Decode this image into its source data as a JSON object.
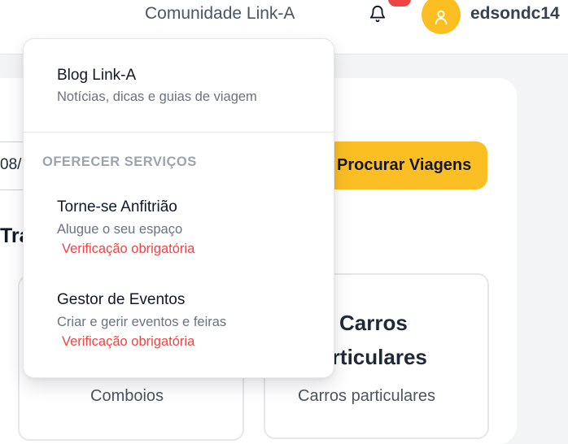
{
  "header": {
    "community_label": "Comunidade Link-A",
    "username": "edsondc14"
  },
  "icons": {
    "notifications": "bell-icon",
    "user": "user-icon"
  },
  "colors": {
    "accent": "#fbbf24",
    "badge": "#ef4444",
    "warning_text": "#ef4444"
  },
  "search": {
    "date_value": "08/",
    "button_label": "Procurar Viagens"
  },
  "section": {
    "heading": "Tra"
  },
  "tiles": [
    {
      "title": "",
      "subtitle": "Comboios"
    },
    {
      "title_line1": "Carros",
      "title_line2": "Particulares",
      "subtitle": "Carros particulares"
    }
  ],
  "dropdown": {
    "blog": {
      "title": "Blog Link-A",
      "description": "Notícias, dicas e guias de viagem"
    },
    "section_label": "OFERECER SERVIÇOS",
    "items": [
      {
        "title": "Torne-se Anfitrião",
        "description": "Alugue o seu espaço",
        "warning": "Verificação obrigatória"
      },
      {
        "title": "Gestor de Eventos",
        "description": "Criar e gerir eventos e feiras",
        "warning": "Verificação obrigatória"
      }
    ]
  }
}
